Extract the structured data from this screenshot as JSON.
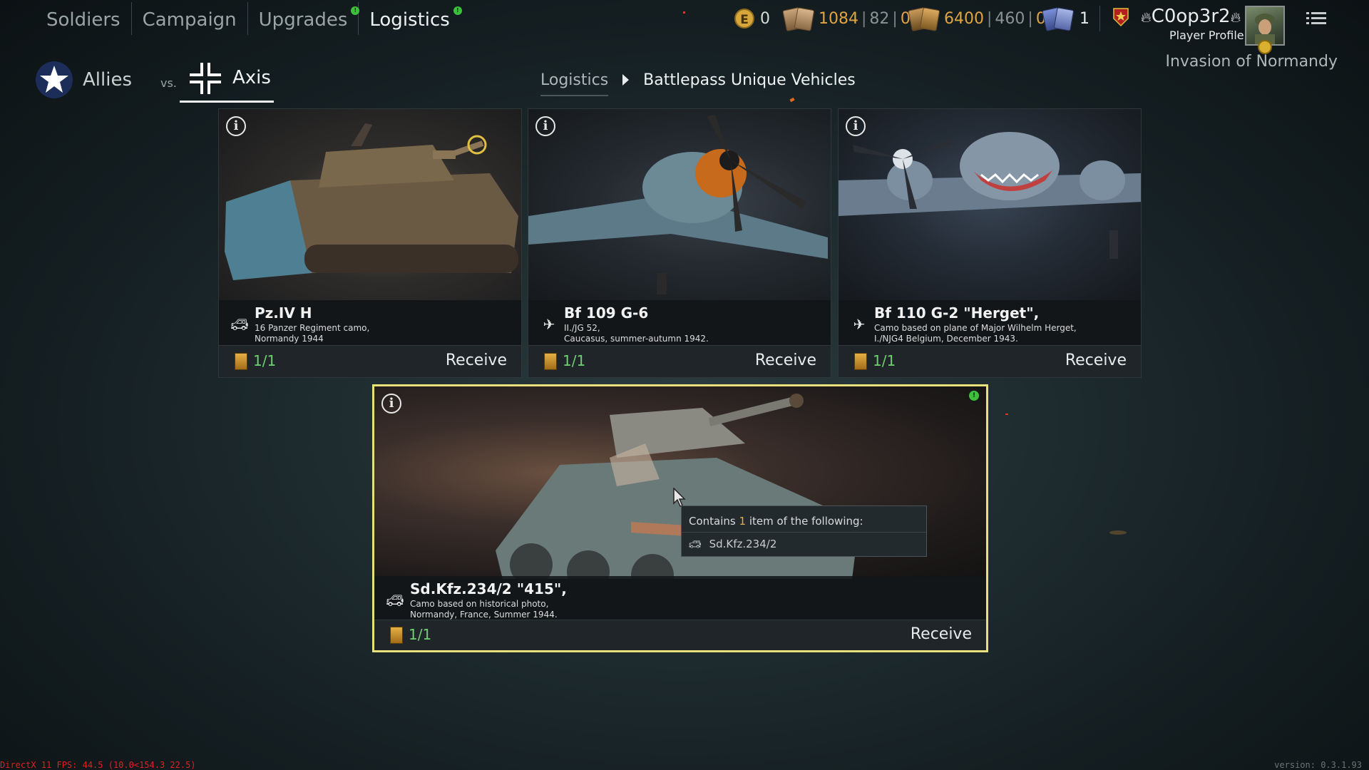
{
  "nav": {
    "tabs": [
      {
        "label": "Soldiers"
      },
      {
        "label": "Campaign"
      },
      {
        "label": "Upgrades"
      },
      {
        "label": "Logistics"
      }
    ]
  },
  "resources": {
    "e_coins": "0",
    "silver_cards": {
      "a": "1084",
      "b": "82",
      "c": "0"
    },
    "gold_cards": {
      "a": "6400",
      "b": "460",
      "c": "0"
    },
    "blue_cards": "1"
  },
  "player": {
    "name": "C0op3r2",
    "profile_label": "Player Profile",
    "campaign": "Invasion of Normandy"
  },
  "sides": {
    "allies": "Allies",
    "vs": "vs.",
    "axis": "Axis"
  },
  "breadcrumb": {
    "parent": "Logistics",
    "current": "Battlepass Unique Vehicles"
  },
  "cards": [
    {
      "title": "Pz.IV H",
      "desc": "16 Panzer Regiment camo,\nNormandy 1944",
      "count": "1/1",
      "action": "Receive",
      "type_icon": "tank-icon"
    },
    {
      "title": "Bf 109 G-6",
      "desc": "II./JG 52,\nCaucasus, summer-autumn 1942.",
      "count": "1/1",
      "action": "Receive",
      "type_icon": "fighter-plane-icon"
    },
    {
      "title": "Bf 110 G-2 \"Herget\",",
      "desc": "Camo based on plane of Major Wilhelm Herget,\nI./NJG4 Belgium, December 1943.",
      "count": "1/1",
      "action": "Receive",
      "type_icon": "fighter-plane-icon"
    },
    {
      "title": "Sd.Kfz.234/2 \"415\",",
      "desc": "Camo based on historical photo,\nNormandy, France, Summer 1944.",
      "count": "1/1",
      "action": "Receive",
      "type_icon": "tank-icon"
    }
  ],
  "tooltip": {
    "prefix": "Contains ",
    "amount": "1",
    "suffix": " item of the following:",
    "item": "Sd.Kfz.234/2"
  },
  "footer": {
    "fps": "DirectX 11 FPS: 44.5 (10.0<154.3 22.5)",
    "version": "version: 0.3.1.93"
  },
  "colors": {
    "accent_yellow": "#e8e07a",
    "count_green": "#6fd06f",
    "resource_orange": "#e0a443",
    "notify_green": "#3cc13c"
  }
}
